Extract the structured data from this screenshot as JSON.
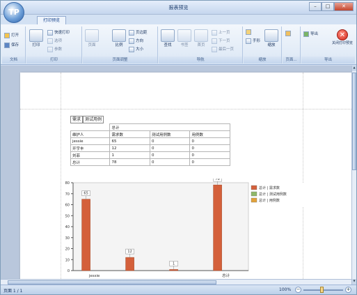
{
  "window": {
    "title": "报表预览",
    "app_logo": "TP",
    "buttons": {
      "minimize": "–",
      "maximize": "□",
      "close": "✕"
    }
  },
  "ribbon": {
    "active_tab": "打印预览",
    "groups": {
      "file": {
        "label": "文档",
        "open": "打开",
        "save": "保存"
      },
      "print": {
        "label": "打印",
        "print": "打印",
        "quick_print": "快速打印",
        "options": "选项",
        "params": "参数"
      },
      "page_setup": {
        "label": "页面调整",
        "margins": "页边距",
        "orientation": "方向",
        "size": "大小",
        "header_footer": "页眉",
        "page": "页面",
        "scale": "比例"
      },
      "nav": {
        "label": "导航",
        "first": "首页",
        "prev": "上一页",
        "next": "下一页",
        "last": "最后一页",
        "find": "查找",
        "thumb": "书签"
      },
      "zoom": {
        "label": "缩放",
        "pointer": "指针",
        "hand": "手形",
        "zoom": "缩放"
      },
      "page_bg": {
        "label": "页面..."
      },
      "export": {
        "label": "导出",
        "export_btn": "导出",
        "close": "关闭打印预览"
      }
    },
    "icons": [
      "open-icon",
      "save-icon",
      "print-icon",
      "quick-print-icon",
      "options-icon",
      "params-icon",
      "margins-icon",
      "orientation-icon",
      "size-icon",
      "find-icon",
      "first-page-icon",
      "prev-page-icon",
      "next-page-icon",
      "last-page-icon",
      "pointer-icon",
      "hand-icon",
      "zoom-icon",
      "page-color-icon",
      "export-icon",
      "close-preview-icon"
    ]
  },
  "report": {
    "header_cells": [
      "需求",
      "测试用例"
    ],
    "group_header": "总计",
    "columns": [
      "维护人",
      "需求数",
      "测试用例数",
      "用例数"
    ],
    "rows": [
      [
        "jessie",
        "65",
        "0",
        "0"
      ],
      [
        "开宇丰",
        "12",
        "0",
        "0"
      ],
      [
        "刘菲",
        "1",
        "0",
        "0"
      ],
      [
        "总计",
        "78",
        "0",
        "0"
      ]
    ]
  },
  "chart_data": {
    "type": "bar",
    "categories": [
      "jessie",
      "开宇丰",
      "刘菲",
      "总计"
    ],
    "x_tick_labels": [
      "jessie",
      "",
      "",
      "总计"
    ],
    "series": [
      {
        "name": "总计 | 需求数",
        "values": [
          65,
          12,
          1,
          78
        ],
        "color": "#d4603b"
      },
      {
        "name": "总计 | 测试用例数",
        "values": [
          0,
          0,
          0,
          0
        ],
        "color": "#8fb86a"
      },
      {
        "name": "总计 | 用例数",
        "values": [
          0,
          0,
          0,
          0
        ],
        "color": "#e2a23b"
      }
    ],
    "data_labels": [
      "65",
      "12",
      "1",
      "78"
    ],
    "ylim": [
      0,
      80
    ],
    "yticks": [
      0,
      10,
      20,
      30,
      40,
      50,
      60,
      70,
      80
    ],
    "legend": "right",
    "grid": false
  },
  "status": {
    "page_indicator": "页面 1 / 1",
    "zoom": "100%",
    "zoom_minus": "−",
    "zoom_plus": "+"
  },
  "colors": {
    "accent": "#d4603b",
    "ribbon_blue": "#dbe7f5",
    "workspace": "#b9c7dc"
  }
}
